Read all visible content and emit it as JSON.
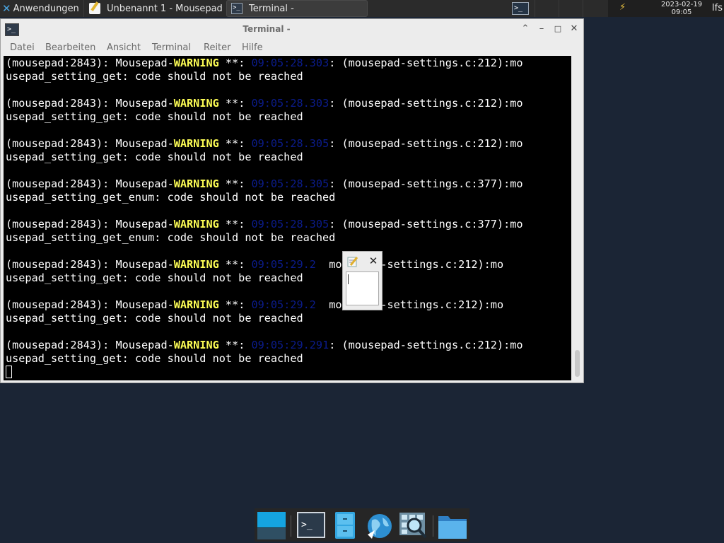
{
  "top_panel": {
    "apps_menu_label": "Anwendungen",
    "tasks": [
      {
        "label": "Unbenannt 1 - Mousepad",
        "icon": "mousepad-icon"
      },
      {
        "label": "Terminal -",
        "icon": "terminal-icon"
      }
    ],
    "tray_terminal_glyph": ">_",
    "power_glyph": "⚡",
    "clock_date": "2023-02-19",
    "clock_time": "09:05",
    "user": "lfs"
  },
  "terminal_window": {
    "title": "Terminal -",
    "menu": [
      "Datei",
      "Bearbeiten",
      "Ansicht",
      "Terminal",
      "Reiter",
      "Hilfe"
    ],
    "lines": [
      {
        "pre": "(mousepad:2843): Mousepad-",
        "warn": "WARNING",
        "mid": " **: ",
        "ts": "09:05:28.303",
        "post": ": (mousepad-settings.c:212):mo"
      },
      {
        "text": "usepad_setting_get: code should not be reached"
      },
      {
        "text": ""
      },
      {
        "pre": "(mousepad:2843): Mousepad-",
        "warn": "WARNING",
        "mid": " **: ",
        "ts": "09:05:28.303",
        "post": ": (mousepad-settings.c:212):mo"
      },
      {
        "text": "usepad_setting_get: code should not be reached"
      },
      {
        "text": ""
      },
      {
        "pre": "(mousepad:2843): Mousepad-",
        "warn": "WARNING",
        "mid": " **: ",
        "ts": "09:05:28.305",
        "post": ": (mousepad-settings.c:212):mo"
      },
      {
        "text": "usepad_setting_get: code should not be reached"
      },
      {
        "text": ""
      },
      {
        "pre": "(mousepad:2843): Mousepad-",
        "warn": "WARNING",
        "mid": " **: ",
        "ts": "09:05:28.305",
        "post": ": (mousepad-settings.c:377):mo"
      },
      {
        "text": "usepad_setting_get_enum: code should not be reached"
      },
      {
        "text": ""
      },
      {
        "pre": "(mousepad:2843): Mousepad-",
        "warn": "WARNING",
        "mid": " **: ",
        "ts": "09:05:28.305",
        "post": ": (mousepad-settings.c:377):mo"
      },
      {
        "text": "usepad_setting_get_enum: code should not be reached"
      },
      {
        "text": ""
      },
      {
        "pre": "(mousepad:2843): Mousepad-",
        "warn": "WARNING",
        "mid": " **: ",
        "ts": "09:05:29.2",
        "post": "  mousepad-settings.c:212):mo"
      },
      {
        "text": "usepad_setting_get: code should not be reached"
      },
      {
        "text": ""
      },
      {
        "pre": "(mousepad:2843): Mousepad-",
        "warn": "WARNING",
        "mid": " **: ",
        "ts": "09:05:29.2",
        "post": "  mousepad-settings.c:212):mo"
      },
      {
        "text": "usepad_setting_get: code should not be reached"
      },
      {
        "text": ""
      },
      {
        "pre": "(mousepad:2843): Mousepad-",
        "warn": "WARNING",
        "mid": " **: ",
        "ts": "09:05:29.291",
        "post": ": (mousepad-settings.c:212):mo"
      },
      {
        "text": "usepad_setting_get: code should not be reached"
      }
    ]
  },
  "popup": {
    "icon": "mousepad-icon",
    "close_glyph": "✕",
    "input_value": ""
  },
  "dock": {
    "items": [
      "show-desktop-icon",
      "terminal-icon",
      "file-cabinet-icon",
      "web-browser-icon",
      "search-icon",
      "folder-icon"
    ]
  },
  "colors": {
    "desktop_bg": "#1b2535",
    "panel_bg": "#2b2b2b",
    "terminal_bg": "#000000",
    "warning_fg": "#fcfc54",
    "timestamp_fg": "#0b1c8c"
  }
}
